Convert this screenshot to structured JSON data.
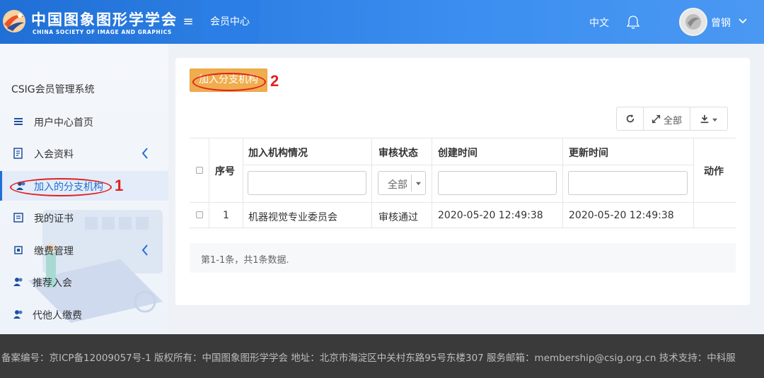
{
  "header": {
    "logo_title": "中国图象图形学学会",
    "logo_subtitle": "CHINA SOCIETY OF IMAGE AND GRAPHICS",
    "active_nav": "会员中心",
    "language": "中文",
    "username": "曾钢"
  },
  "sidebar": {
    "system_title": "CSIG会员管理系统",
    "items": [
      {
        "label": "用户中心首页",
        "icon": "list-icon"
      },
      {
        "label": "入会资料",
        "icon": "document-icon"
      },
      {
        "label": "加入的分支机构",
        "icon": "users-icon"
      },
      {
        "label": "我的证书",
        "icon": "certificate-icon"
      },
      {
        "label": "缴费管理",
        "icon": "payment-icon"
      },
      {
        "label": "推荐入会",
        "icon": "users-icon"
      },
      {
        "label": "代他人缴费",
        "icon": "users-icon"
      }
    ]
  },
  "annotations": {
    "one": "1",
    "two": "2"
  },
  "main": {
    "join_button": "加入分支机构",
    "toolbar": {
      "full_label": "全部"
    },
    "table": {
      "headers": {
        "index": "序号",
        "org": "加入机构情况",
        "status": "审核状态",
        "created": "创建时间",
        "updated": "更新时间",
        "action": "动作"
      },
      "status_filter": "全部",
      "rows": [
        {
          "index": "1",
          "org": "机器视觉专业委员会",
          "status": "审核通过",
          "created": "2020-05-20 12:49:38",
          "updated": "2020-05-20 12:49:38"
        }
      ]
    },
    "pager_text": "第1-1条，共1条数据."
  },
  "footer": {
    "text": "备案编号：京ICP备12009057号-1 版权所有：中国图象图形学学会 地址：北京市海淀区中关村东路95号东楼307 服务邮箱：membership@csig.org.cn 技术支持：中科服"
  },
  "colors": {
    "header": "#2a7ee5",
    "accent": "#1f6fd6",
    "button": "#f0ad4e",
    "annotation": "#e02020",
    "footer": "#3a3a3a"
  }
}
